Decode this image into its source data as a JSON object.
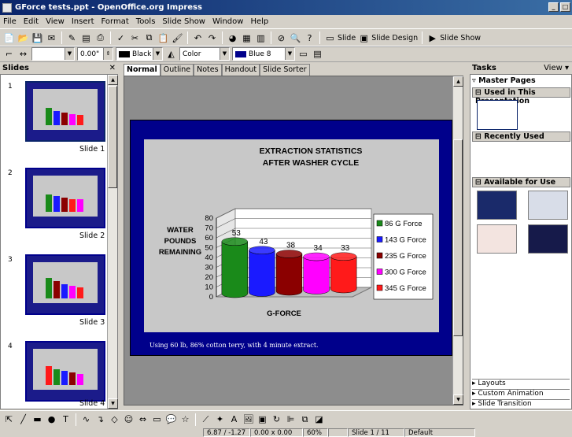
{
  "window": {
    "title": "GForce tests.ppt - OpenOffice.org Impress"
  },
  "menu": [
    "File",
    "Edit",
    "View",
    "Insert",
    "Format",
    "Tools",
    "Slide Show",
    "Window",
    "Help"
  ],
  "toolbar1": {
    "slide_label": "Slide",
    "slide_design_label": "Slide Design",
    "slide_show_label": "Slide Show"
  },
  "toolbar2": {
    "line_width": "0.00\"",
    "line_color": "Black",
    "area_style": "Color",
    "area_color": "Blue 8"
  },
  "slides_panel": {
    "title": "Slides",
    "items": [
      {
        "num": "1",
        "label": "Slide 1"
      },
      {
        "num": "2",
        "label": "Slide 2"
      },
      {
        "num": "3",
        "label": "Slide 3"
      },
      {
        "num": "4",
        "label": "Slide 4"
      }
    ]
  },
  "view_tabs": [
    "Normal",
    "Outline",
    "Notes",
    "Handout",
    "Slide Sorter"
  ],
  "slide": {
    "footnote": "Using 60 lb, 86% cotton terry, with 4 minute extract."
  },
  "chart_data": {
    "type": "bar",
    "title": "EXTRACTION STATISTICS AFTER WASHER CYCLE",
    "title_lines": [
      "EXTRACTION STATISTICS",
      "AFTER WASHER CYCLE"
    ],
    "xlabel": "G-FORCE",
    "ylabel": "WATER POUNDS REMAINING",
    "ylabel_lines": [
      "WATER",
      "POUNDS",
      "REMAINING"
    ],
    "ylim": [
      0,
      80
    ],
    "yticks": [
      0,
      10,
      20,
      30,
      40,
      50,
      60,
      70,
      80
    ],
    "series": [
      {
        "name": "86 G Force",
        "value": 53,
        "color": "#1a8a1a"
      },
      {
        "name": "143 G Force",
        "value": 43,
        "color": "#1a1aff"
      },
      {
        "name": "235 G Force",
        "value": 38,
        "color": "#8b0000"
      },
      {
        "name": "300 G Force",
        "value": 34,
        "color": "#ff00ff"
      },
      {
        "name": "345 G Force",
        "value": 33,
        "color": "#ff1a1a"
      }
    ],
    "legend": "right"
  },
  "tasks_panel": {
    "title": "Tasks",
    "view_label": "View",
    "section": "Master Pages",
    "groups": {
      "used": "Used in This Presentation",
      "recent": "Recently Used",
      "available": "Available for Use"
    },
    "bottom": [
      "Layouts",
      "Custom Animation",
      "Slide Transition"
    ]
  },
  "statusbar": {
    "position": "6.87 / -1.27",
    "size": "0.00 x 0.00",
    "zoom": "60%",
    "slide": "Slide 1 / 11",
    "layout": "Default"
  }
}
